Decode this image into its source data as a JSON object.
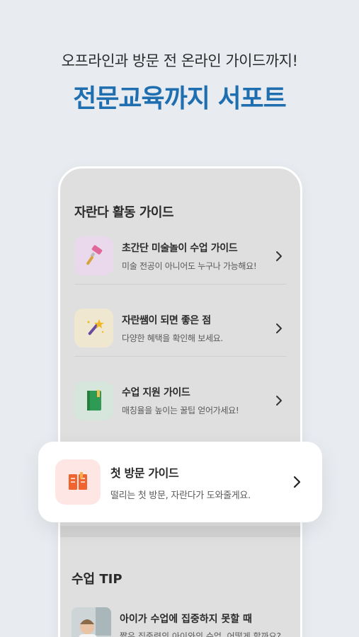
{
  "header": {
    "subtitle": "오프라인과 방문 전 온라인 가이드까지!",
    "title": "전문교육까지 서포트"
  },
  "guide_section": {
    "title": "자란다 활동 가이드",
    "items": [
      {
        "title": "초간단 미술놀이 수업 가이드",
        "subtitle": "미술 전공이 아니어도 누구나 가능해요!",
        "icon": "brush-icon",
        "bg": "#ead9ec"
      },
      {
        "title": "자란쌤이 되면 좋은 점",
        "subtitle": "다양한 혜택을 확인해 보세요.",
        "icon": "magic-wand-icon",
        "bg": "#efe7cf"
      },
      {
        "title": "수업 지원 가이드",
        "subtitle": "매칭율을 높이는 꿀팁 얻어가세요!",
        "icon": "notebook-icon",
        "bg": "#d6e6dc"
      }
    ]
  },
  "featured_card": {
    "title": "첫 방문 가이드",
    "subtitle": "떨리는 첫 방문, 자란다가 도와줄게요.",
    "icon": "book-icon",
    "bg": "#fde6e3"
  },
  "tip_section": {
    "title": "수업 TIP",
    "item": {
      "title": "아이가 수업에 집중하지 못할 때",
      "subtitle": "짧은 집중력의 아이와의 수업, 어떻게 할까요?"
    }
  },
  "colors": {
    "accent": "#1f6fb0",
    "background": "#e8ecf1"
  }
}
